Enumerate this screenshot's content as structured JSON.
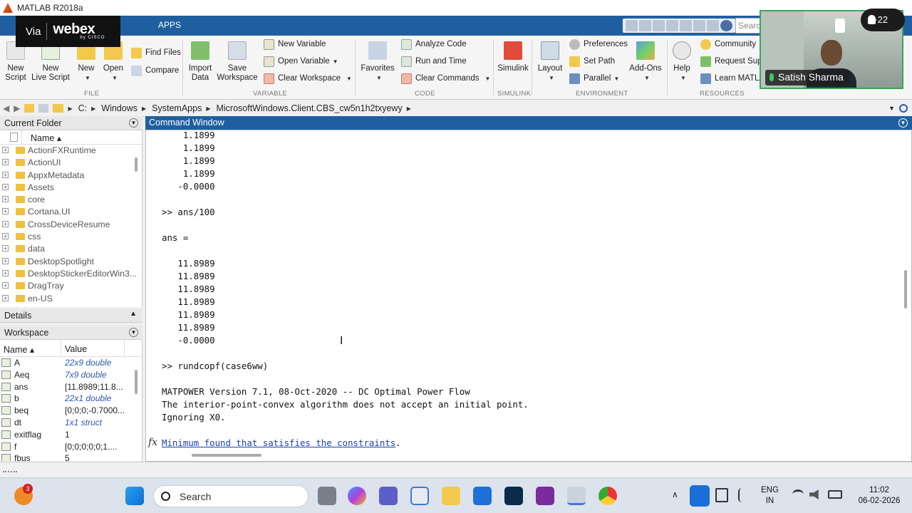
{
  "window": {
    "title": "MATLAB R2018a"
  },
  "webex": {
    "via": "Via",
    "brand": "webex",
    "sub": "by CISCO"
  },
  "tabs": {
    "apps": "APPS"
  },
  "search": {
    "placeholder": "Search"
  },
  "ribbon": {
    "new_script": "New\nScript",
    "new_live_script": "New\nLive Script",
    "new": "New",
    "open": "Open",
    "find_files": "Find Files",
    "compare": "Compare",
    "import_data": "Import\nData",
    "save_workspace": "Save\nWorkspace",
    "new_variable": "New Variable",
    "open_variable": "Open Variable",
    "clear_workspace": "Clear Workspace",
    "favorites": "Favorites",
    "analyze_code": "Analyze Code",
    "run_and_time": "Run and Time",
    "clear_commands": "Clear Commands",
    "simulink": "Simulink",
    "layout": "Layout",
    "preferences": "Preferences",
    "set_path": "Set Path",
    "parallel": "Parallel",
    "add_ons": "Add-Ons",
    "help": "Help",
    "community": "Community",
    "request_support": "Request Supp",
    "learn_matlab": "Learn MATLA",
    "groups": {
      "file": "FILE",
      "variable": "VARIABLE",
      "code": "CODE",
      "simulink": "SIMULINK",
      "environment": "ENVIRONMENT",
      "resources": "RESOURCES"
    }
  },
  "path": {
    "segments": [
      "C:",
      "Windows",
      "SystemApps",
      "MicrosoftWindows.Client.CBS_cw5n1h2txyewy"
    ]
  },
  "current_folder": {
    "title": "Current Folder",
    "col_name": "Name ▴",
    "items": [
      "ActionFXRuntime",
      "ActionUI",
      "AppxMetadata",
      "Assets",
      "core",
      "Cortana.UI",
      "CrossDeviceResume",
      "css",
      "data",
      "DesktopSpotlight",
      "DesktopStickerEditorWin3...",
      "DragTray",
      "en-US"
    ]
  },
  "details": {
    "title": "Details"
  },
  "workspace": {
    "title": "Workspace",
    "col_name": "Name ▴",
    "col_value": "Value",
    "rows": [
      {
        "name": "A",
        "value": "22x9 double",
        "cls": true
      },
      {
        "name": "Aeq",
        "value": "7x9 double",
        "cls": true
      },
      {
        "name": "ans",
        "value": "[11.8989;11.8...",
        "cls": false
      },
      {
        "name": "b",
        "value": "22x1 double",
        "cls": true
      },
      {
        "name": "beq",
        "value": "[0;0;0;-0.7000...",
        "cls": false
      },
      {
        "name": "dt",
        "value": "1x1 struct",
        "cls": true
      },
      {
        "name": "exitflag",
        "value": "1",
        "cls": false
      },
      {
        "name": "f",
        "value": "[0;0;0;0;0;1....",
        "cls": false
      },
      {
        "name": "fbus",
        "value": "5",
        "cls": false
      }
    ]
  },
  "command_window": {
    "title": "Command Window",
    "lines": [
      "    1.1899",
      "    1.1899",
      "    1.1899",
      "    1.1899",
      "   -0.0000",
      "",
      ">> ans/100",
      "",
      "ans =",
      "",
      "   11.8989",
      "   11.8989",
      "   11.8989",
      "   11.8989",
      "   11.8989",
      "   11.8989",
      "   -0.0000",
      "",
      ">> rundcopf(case6ww)",
      "",
      "MATPOWER Version 7.1, 08-Oct-2020 -- DC Optimal Power Flow",
      "The interior-point-convex algorithm does not accept an initial point.",
      "Ignoring X0.",
      ""
    ],
    "fx": "fx",
    "link_text": "Minimum found that satisfies the constraints",
    "link_tail": "."
  },
  "video": {
    "name": "Satish Sharma",
    "participants": "+22"
  },
  "taskbar": {
    "search": "Search",
    "notif_count": "3",
    "lang": "ENG",
    "region": "IN",
    "time": "11:02",
    "date": "06-02-2026"
  },
  "colors": {
    "accent": "#1f5fa0",
    "link": "#1a3fb0",
    "video_border": "#3fa35a"
  }
}
